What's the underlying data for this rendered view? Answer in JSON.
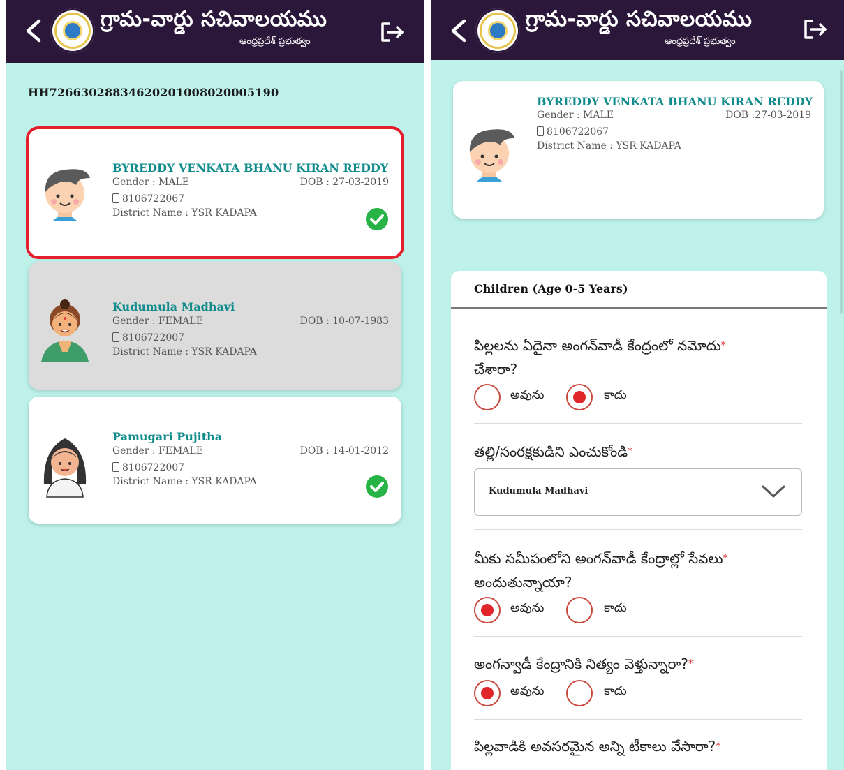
{
  "app": {
    "title": "గ్రామ-వార్డు సచివాలయము",
    "subtitle": "ఆంధ్రప్రదేశ్ ప్రభుత్వం"
  },
  "household": {
    "id": "HH72663028834620201008020005190"
  },
  "members": [
    {
      "name": "BYREDDY VENKATA BHANU KIRAN REDDY",
      "gender": "Gender : MALE",
      "dob": "DOB : 27-03-2019",
      "phone": "8106722067",
      "district": "District Name : YSR KADAPA",
      "completed": true,
      "selected": true
    },
    {
      "name": "Kudumula Madhavi",
      "gender": "Gender : FEMALE",
      "dob": "DOB : 10-07-1983",
      "phone": "8106722007",
      "district": "District Name : YSR KADAPA",
      "completed": false,
      "selected": false
    },
    {
      "name": "Pamugari Pujitha",
      "gender": "Gender : FEMALE",
      "dob": "DOB : 14-01-2012",
      "phone": "8106722007",
      "district": "District Name : YSR KADAPA",
      "completed": true,
      "selected": false
    }
  ],
  "detail": {
    "name": "BYREDDY VENKATA BHANU KIRAN REDDY",
    "gender": "Gender : MALE",
    "dob": "DOB :27-03-2019",
    "phone": "8106722067",
    "district": "District Name : YSR KADAPA"
  },
  "form": {
    "section_title": "Children (Age 0-5 Years)",
    "yes_label": "అవును",
    "no_label": "కాదు",
    "required_mark": "*",
    "q1_line1": "పిల్లలను ఏదైనా అంగన్‌వాడీ కేంద్రంలో నమోదు",
    "q1_line2": "చేశారా?",
    "q1_answer": "no",
    "q2": "తల్లి/సంరక్షకుడిని ఎంచుకోండి",
    "q2_value": "Kudumula Madhavi",
    "q3_line1": "మీకు సమీపంలోని అంగన్‌వాడీ కేంద్రాల్లో సేవలు",
    "q3_line2": "అందుతున్నాయా?",
    "q3_answer": "yes",
    "q4": "అంగన్వాడీ కేంద్రానికి నిత్యం వెళ్తున్నారా?",
    "q4_answer": "yes",
    "q5": "పిల్లవాడికి అవసరమైన అన్ని టీకాలు వేసారా?"
  },
  "icons": {
    "back": "chevron-left-icon",
    "logout": "logout-icon",
    "check": "check-circle-icon",
    "dropdown": "chevron-down-icon"
  },
  "colors": {
    "appbar": "#2b1739",
    "background": "#bdf1ea",
    "name_teal": "#0f8b8b",
    "selected_border": "#e41e2a",
    "check_green": "#27b345",
    "radio_red": "#e0252b"
  }
}
